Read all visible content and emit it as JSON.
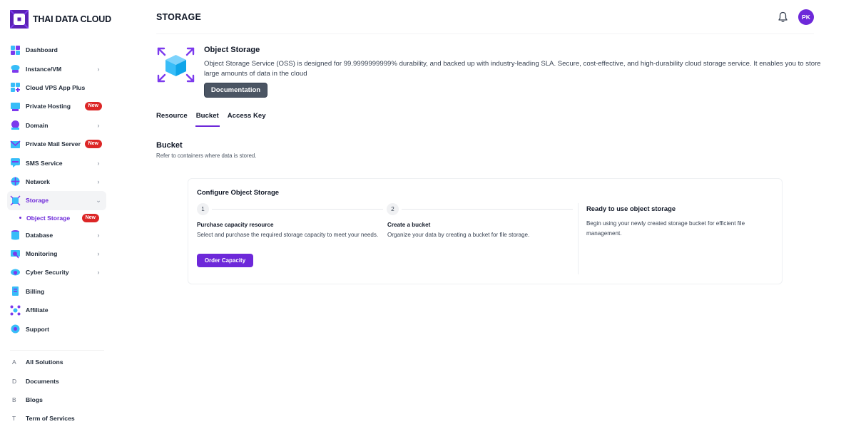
{
  "brand": {
    "name": "THAI DATA CLOUD"
  },
  "colors": {
    "accent": "#6d28d9",
    "badge": "#dc2626",
    "icon_blue": "#38bdf8"
  },
  "sidebar": {
    "items": [
      {
        "label": "Dashboard",
        "icon": "dashboard-icon",
        "chevron": false,
        "badge": ""
      },
      {
        "label": "Instance/VM",
        "icon": "instance-vm-icon",
        "chevron": true,
        "badge": ""
      },
      {
        "label": "Cloud VPS App Plus",
        "icon": "cloud-vps-icon",
        "chevron": false,
        "badge": ""
      },
      {
        "label": "Private Hosting",
        "icon": "private-hosting-icon",
        "chevron": false,
        "badge": "New"
      },
      {
        "label": "Domain",
        "icon": "domain-icon",
        "chevron": true,
        "badge": ""
      },
      {
        "label": "Private Mail Server",
        "icon": "mail-server-icon",
        "chevron": false,
        "badge": "New"
      },
      {
        "label": "SMS Service",
        "icon": "sms-icon",
        "chevron": true,
        "badge": ""
      },
      {
        "label": "Network",
        "icon": "network-icon",
        "chevron": true,
        "badge": ""
      },
      {
        "label": "Storage",
        "icon": "storage-icon",
        "chevron": true,
        "badge": "",
        "expanded": true,
        "sub": [
          {
            "label": "Object Storage",
            "badge": "New"
          }
        ]
      },
      {
        "label": "Database",
        "icon": "database-icon",
        "chevron": true,
        "badge": ""
      },
      {
        "label": "Monitoring",
        "icon": "monitoring-icon",
        "chevron": true,
        "badge": ""
      },
      {
        "label": "Cyber Security",
        "icon": "cyber-security-icon",
        "chevron": true,
        "badge": ""
      },
      {
        "label": "Billing",
        "icon": "billing-icon",
        "chevron": false,
        "badge": ""
      },
      {
        "label": "Affiliate",
        "icon": "affiliate-icon",
        "chevron": false,
        "badge": ""
      },
      {
        "label": "Support",
        "icon": "support-icon",
        "chevron": false,
        "badge": ""
      }
    ],
    "footer": [
      {
        "letter": "A",
        "label": "All Solutions"
      },
      {
        "letter": "D",
        "label": "Documents"
      },
      {
        "letter": "B",
        "label": "Blogs"
      },
      {
        "letter": "T",
        "label": "Term of Services"
      }
    ]
  },
  "header": {
    "title": "STORAGE",
    "avatar_initials": "PK",
    "bell_icon": "bell-icon"
  },
  "hero": {
    "title": "Object Storage",
    "description": "Object Storage Service (OSS) is designed for 99.9999999999% durability, and backed up with industry-leading SLA. Secure, cost-effective, and high-durability cloud storage service. It enables you to store large amounts of data in the cloud",
    "doc_button": "Documentation",
    "icon": "object-storage-box-icon"
  },
  "tabs": [
    {
      "label": "Resource",
      "active": false
    },
    {
      "label": "Bucket",
      "active": true
    },
    {
      "label": "Access Key",
      "active": false
    }
  ],
  "section": {
    "title": "Bucket",
    "subtitle": "Refer to containers where data is stored."
  },
  "card": {
    "title": "Configure Object Storage",
    "steps": [
      {
        "num": "1",
        "title": "Purchase capacity resource",
        "desc": "Select and purchase the required storage capacity to meet your needs.",
        "button": "Order Capacity"
      },
      {
        "num": "2",
        "title": "Create a bucket",
        "desc": "Organize your data by creating a bucket for file storage."
      }
    ],
    "ready": {
      "title": "Ready to use object storage",
      "desc": "Begin using your newly created storage bucket for efficient file management."
    }
  }
}
